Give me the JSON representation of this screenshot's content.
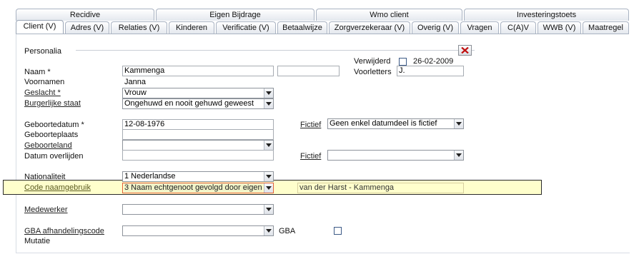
{
  "tabs_top": [
    "Recidive",
    "Eigen Bijdrage",
    "Wmo client",
    "Investeringstoets"
  ],
  "tabs_bottom": [
    "Client (V)",
    "Adres (V)",
    "Relaties (V)",
    "Kinderen",
    "Verificatie (V)",
    "Betaalwijze",
    "Zorgverzekeraar (V)",
    "Overig (V)",
    "Vragen",
    "C(A)V",
    "WWB (V)",
    "Maatregel"
  ],
  "section": {
    "title": "Personalia",
    "close_icon": "close-x-icon"
  },
  "verwijderd": {
    "label": "Verwijderd",
    "checked": false,
    "date": "26-02-2009"
  },
  "naam": {
    "label": "Naam *",
    "value": "Kammenga",
    "extra_value": ""
  },
  "voorletters": {
    "label": "Voorletters",
    "value": "J."
  },
  "voornamen": {
    "label": "Voornamen",
    "value": "Janna"
  },
  "geslacht": {
    "label": "Geslacht *",
    "value": "Vrouw"
  },
  "burgerlijke_staat": {
    "label": "Burgerlijke staat",
    "value": "Ongehuwd en nooit gehuwd geweest"
  },
  "geboortedatum": {
    "label": "Geboortedatum *",
    "value": "12-08-1976"
  },
  "fictief1": {
    "label": "Fictief",
    "value": "Geen enkel datumdeel is fictief"
  },
  "geboorteplaats": {
    "label": "Geboorteplaats",
    "value": ""
  },
  "geboorteland": {
    "label": "Geboorteland",
    "value": ""
  },
  "datum_overlijden": {
    "label": "Datum overlijden",
    "value": ""
  },
  "fictief2": {
    "label": "Fictief",
    "value": ""
  },
  "nationaliteit": {
    "label": "Nationaliteit",
    "value": "1 Nederlandse"
  },
  "code_naamgebruik": {
    "label": "Code naamgebruik",
    "value": "3 Naam echtgenoot gevolgd door eigen",
    "result": "van der Harst - Kammenga"
  },
  "medewerker": {
    "label": "Medewerker",
    "value": ""
  },
  "gba": {
    "label": "GBA afhandelingscode",
    "label2": "Mutatie",
    "value": "",
    "gba_label": "GBA",
    "gba_checked": false
  }
}
